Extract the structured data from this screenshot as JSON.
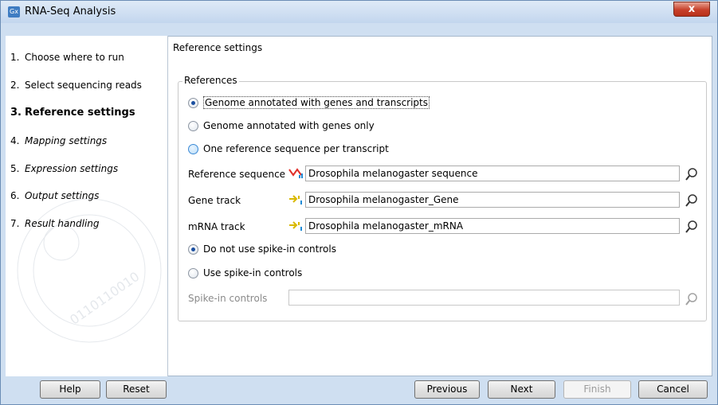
{
  "window": {
    "title": "RNA-Seq Analysis",
    "app_icon_text": "Gx",
    "close_symbol": "x"
  },
  "steps": [
    {
      "num": "1.",
      "label": "Choose where to run"
    },
    {
      "num": "2.",
      "label": "Select sequencing reads"
    },
    {
      "num": "3.",
      "label": "Reference settings"
    },
    {
      "num": "4.",
      "label": "Mapping settings"
    },
    {
      "num": "5.",
      "label": "Expression settings"
    },
    {
      "num": "6.",
      "label": "Output settings"
    },
    {
      "num": "7.",
      "label": "Result handling"
    }
  ],
  "page": {
    "section_title": "Reference settings",
    "group_legend": "References"
  },
  "reference_options": [
    {
      "label": "Genome annotated with genes and transcripts",
      "selected": true
    },
    {
      "label": "Genome annotated with genes only",
      "selected": false
    },
    {
      "label": "One reference sequence per transcript",
      "selected": false
    }
  ],
  "fields": {
    "reference_sequence": {
      "label": "Reference sequence",
      "value": "Drosophila melanogaster sequence",
      "icon": "sequence-track-icon"
    },
    "gene_track": {
      "label": "Gene track",
      "value": "Drosophila melanogaster_Gene",
      "icon": "annotation-track-icon"
    },
    "mrna_track": {
      "label": "mRNA track",
      "value": "Drosophila melanogaster_mRNA",
      "icon": "annotation-track-icon"
    },
    "spike_in": {
      "label": "Spike-in controls",
      "value": ""
    }
  },
  "spike_options": [
    {
      "label": "Do not use spike-in controls",
      "selected": true
    },
    {
      "label": "Use spike-in controls",
      "selected": false
    }
  ],
  "buttons": {
    "help": "Help",
    "reset": "Reset",
    "previous": "Previous",
    "next": "Next",
    "finish": "Finish",
    "cancel": "Cancel"
  },
  "colors": {
    "titlebar": "#c3d6ee",
    "close": "#c7412a",
    "radio_dot": "#1b4fa0"
  }
}
